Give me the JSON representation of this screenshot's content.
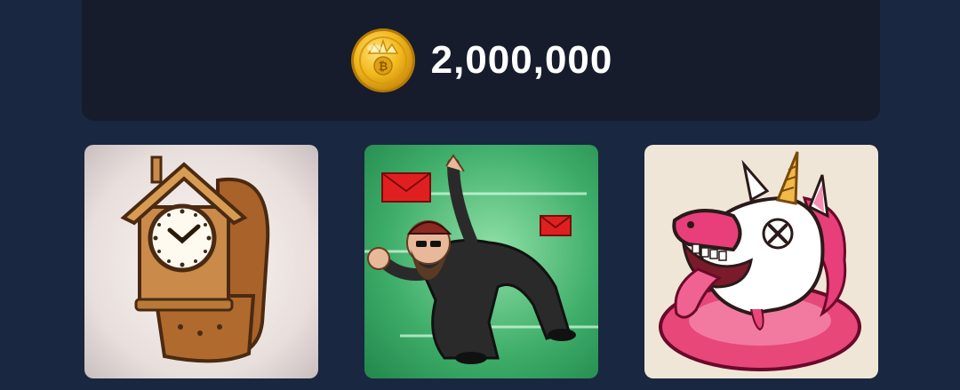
{
  "balance": {
    "icon": "coin-icon",
    "value": "2,000,000"
  },
  "cards": [
    {
      "icon": "cuckoo-clock-watch-icon"
    },
    {
      "icon": "dodging-bearded-man-with-mail-icon"
    },
    {
      "icon": "melting-unicorn-icon"
    }
  ],
  "colors": {
    "background": "#1a2740",
    "balance_card": "#161c2c",
    "coin_gold": "#f2b91e",
    "text": "#ffffff"
  }
}
